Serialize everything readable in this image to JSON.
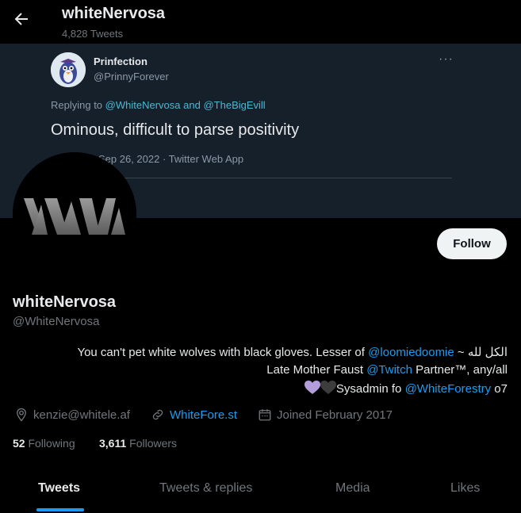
{
  "header": {
    "back_icon": "arrow-left-icon",
    "name": "whiteNervosa",
    "tweet_count": "4,828 Tweets"
  },
  "banner_tweet": {
    "author_name": "Prinfection",
    "author_handle": "@PrinnyForever",
    "more_label": "···",
    "replying_prefix": "Replying to",
    "replying_handle_1": "@WhiteNervosa",
    "replying_and": "and",
    "replying_handle_2": "@TheBigEvill",
    "text": "Ominous, difficult to parse positivity",
    "date_app": "Sep 26, 2022 · Twitter Web App"
  },
  "profile": {
    "name": "whiteNervosa",
    "handle": "@WhiteNervosa",
    "follow_label": "Follow",
    "bio": {
      "line1_a": "You can't pet white wolves with black gloves. Lesser of ",
      "line1_link": "@loomiedoomie",
      "line1_b": " ~ الكل لله",
      "line2_a": "Late Mother Faust ",
      "line2_link": "@Twitch",
      "line2_b": " Partner™, any/all",
      "line3_a": "Sysadmin fo ",
      "line3_link": "@WhiteForestry",
      "line3_b": " o7"
    },
    "location": "kenzie@whitele.af",
    "website": "WhiteFore.st",
    "joined": "Joined February 2017",
    "following_count": "52",
    "following_label": "Following",
    "followers_count": "3,611",
    "followers_label": "Followers"
  },
  "tabs": [
    {
      "label": "Tweets",
      "active": true
    },
    {
      "label": "Tweets & replies",
      "active": false
    },
    {
      "label": "Media",
      "active": false
    },
    {
      "label": "Likes",
      "active": false
    }
  ],
  "colors": {
    "background": "#000000",
    "accent": "#1d9bf0",
    "banner_bg": "#15202b",
    "muted_text": "#71767b"
  }
}
